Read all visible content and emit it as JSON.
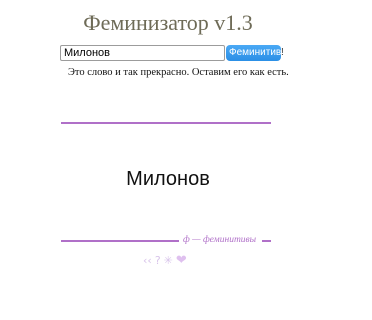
{
  "app": {
    "title": "Феминизатор v1.3"
  },
  "form": {
    "input_value": "Милонов",
    "button_label": "Феминитив",
    "button_overflow": "!"
  },
  "status": {
    "message": "Это слово и так прекрасно. Оставим его как есть."
  },
  "result": {
    "word": "Милонов"
  },
  "footer": {
    "caption": "ф — феминитивы",
    "icons": {
      "share": "‹‹",
      "help": "?",
      "snowflake": "✳",
      "heart": "❤"
    }
  },
  "colors": {
    "accent": "#b070c8",
    "button": "#2b8fe6",
    "title": "#6e6b57"
  }
}
